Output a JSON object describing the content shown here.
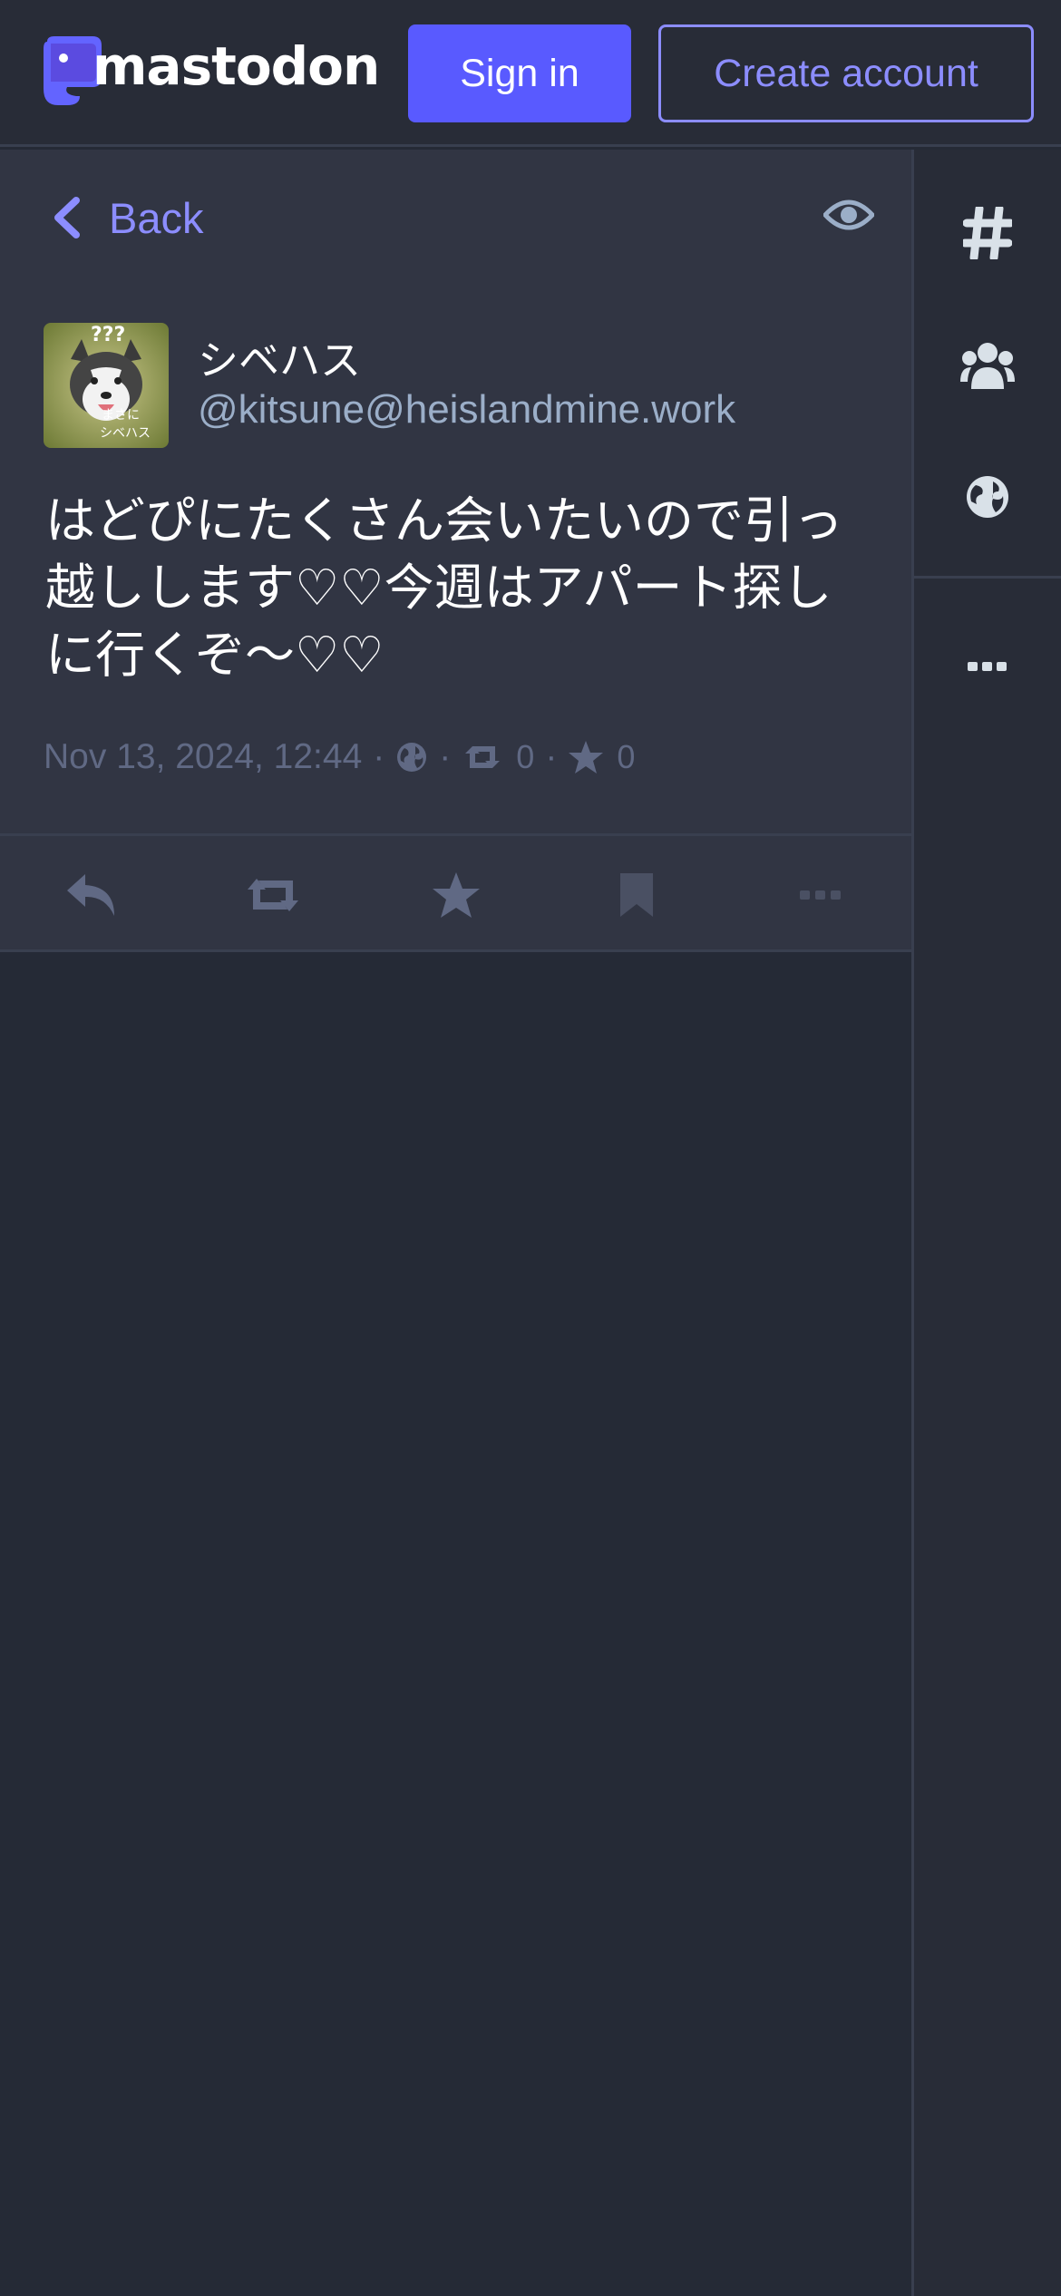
{
  "header": {
    "logo_text": "mastodon",
    "sign_in_label": "Sign in",
    "create_account_label": "Create account"
  },
  "nav": {
    "back_label": "Back"
  },
  "status": {
    "display_name": "シベハス",
    "acct": "@kitsune@heislandmine.work",
    "content": "はどぴにたくさん会いたいので引っ越しします♡♡今週はアパート探しに行くぞ〜♡♡",
    "timestamp": "Nov 13, 2024, 12:44",
    "separator": "·",
    "visibility_icon": "globe-icon",
    "reblogs_count": "0",
    "favourites_count": "0"
  },
  "actions": [
    "reply-icon",
    "boost-icon",
    "star-icon",
    "bookmark-icon",
    "ellipsis-icon"
  ],
  "rail": [
    "hashtag-icon",
    "people-icon",
    "globe-icon",
    "ellipsis-icon"
  ],
  "colors": {
    "accent": "#595aff",
    "accent_light": "#8c8dff",
    "panel": "#313543",
    "background": "#252a36",
    "muted_text": "#606984",
    "secondary_text": "#9baec8"
  }
}
